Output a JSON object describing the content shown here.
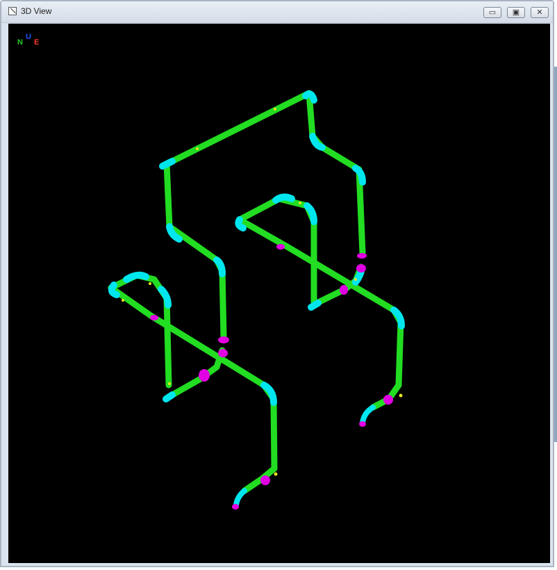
{
  "window": {
    "title": "3D View",
    "controls": {
      "minimize": "▭",
      "maximize": "▣",
      "close": "✕"
    }
  },
  "compass": {
    "north": "N",
    "up": "U",
    "east": "E"
  },
  "colors": {
    "background": "#000000",
    "pipe": "#22dd22",
    "elbow": "#00e6ee",
    "fitting": "#e100e1",
    "weld": "#e6e61e",
    "north": "#22cc22",
    "up": "#2255ff",
    "east": "#ff3b2f"
  }
}
